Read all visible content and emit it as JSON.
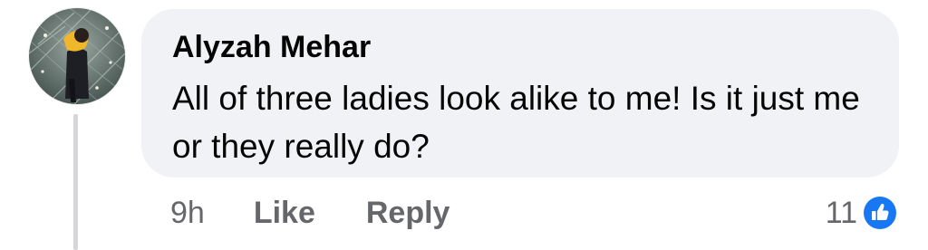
{
  "comment": {
    "author": "Alyzah Mehar",
    "text": "All of three ladies look alike to me! Is it just me or they really do?",
    "timestamp": "9h",
    "actions": {
      "like_label": "Like",
      "reply_label": "Reply"
    },
    "reactions": {
      "count": "11",
      "icon": "thumbs-up-icon",
      "color": "#1877f2"
    }
  },
  "colors": {
    "bubble_background": "#f0f2f5",
    "secondary_text": "#65676b",
    "primary_text": "#050505",
    "thread_line": "#d4d6da"
  }
}
